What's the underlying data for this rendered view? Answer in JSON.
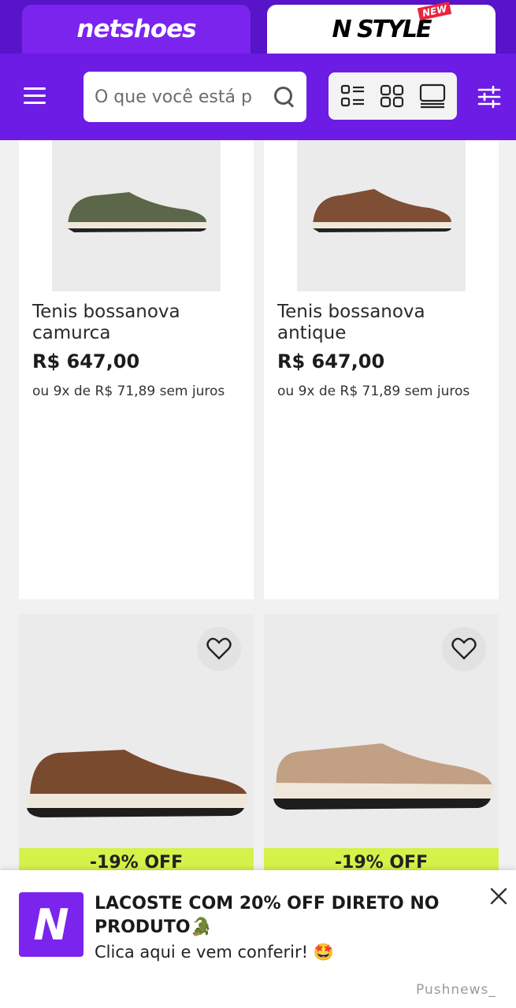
{
  "tabs": {
    "netshoes": "netshoes",
    "nstyle": "N STYLE",
    "new_badge": "NEW"
  },
  "search": {
    "placeholder": "O que você está p"
  },
  "icons": {
    "menu": "hamburger-menu-icon",
    "search": "search-icon",
    "list_view": "list-view-icon",
    "grid_view": "grid-view-icon",
    "single_view": "single-view-icon",
    "filter": "filter-sliders-icon",
    "favorite": "heart-icon",
    "close": "close-icon"
  },
  "colors": {
    "brand_purple": "#6c1ce4",
    "off_badge": "#d4f249"
  },
  "products": [
    {
      "name": "Tenis bossanova camurca",
      "price": "R$ 647,00",
      "installments": "ou 9x de R$ 71,89 sem juros"
    },
    {
      "name": "Tenis bossanova antique",
      "price": "R$ 647,00",
      "installments": "ou 9x de R$ 71,89 sem juros"
    },
    {
      "discount": "-19% OFF"
    },
    {
      "discount": "-19% OFF"
    }
  ],
  "push": {
    "title": "LACOSTE COM 20% OFF DIRETO NO PRODUTO🐊",
    "body": "Clica aqui e vem conferir! 🤩",
    "logo_letter": "N",
    "brand": "Pushnews_"
  }
}
